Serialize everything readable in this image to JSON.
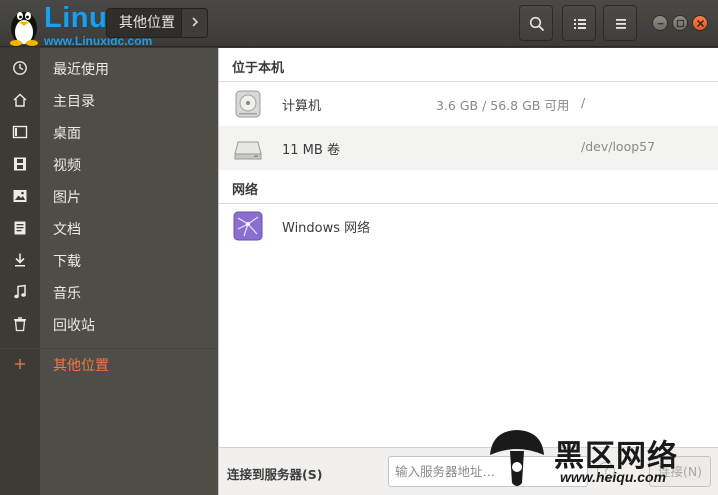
{
  "watermark": {
    "brand": "Linux",
    "site": "www.Linuxidc.com",
    "stamp_text": "黑区网络",
    "stamp_url": "www.heiqu.com"
  },
  "header": {
    "breadcrumb": "其他位置"
  },
  "sidebar": {
    "items": [
      {
        "label": "最近使用",
        "icon": "clock-icon"
      },
      {
        "label": "主目录",
        "icon": "home-icon"
      },
      {
        "label": "桌面",
        "icon": "desktop-icon"
      },
      {
        "label": "视频",
        "icon": "video-icon"
      },
      {
        "label": "图片",
        "icon": "picture-icon"
      },
      {
        "label": "文档",
        "icon": "document-icon"
      },
      {
        "label": "下载",
        "icon": "download-icon"
      },
      {
        "label": "音乐",
        "icon": "music-icon"
      },
      {
        "label": "回收站",
        "icon": "trash-icon"
      },
      {
        "label": "其他位置",
        "icon": "plus-icon"
      }
    ],
    "active_color": "#f07746"
  },
  "main": {
    "on_this_computer": {
      "title": "位于本机",
      "rows": [
        {
          "name": "计算机",
          "size": "3.6 GB / 56.8 GB 可用",
          "path": "/",
          "icon": "harddisk-icon"
        },
        {
          "name": "11 MB 卷",
          "size": "",
          "path": "/dev/loop57",
          "icon": "drive-icon"
        }
      ]
    },
    "networks": {
      "title": "网络",
      "rows": [
        {
          "name": "Windows 网络",
          "icon": "network-icon"
        }
      ]
    }
  },
  "footer": {
    "label": "连接到服务器(S)",
    "input_placeholder": "输入服务器地址…",
    "connect_button": "连接(N)"
  }
}
